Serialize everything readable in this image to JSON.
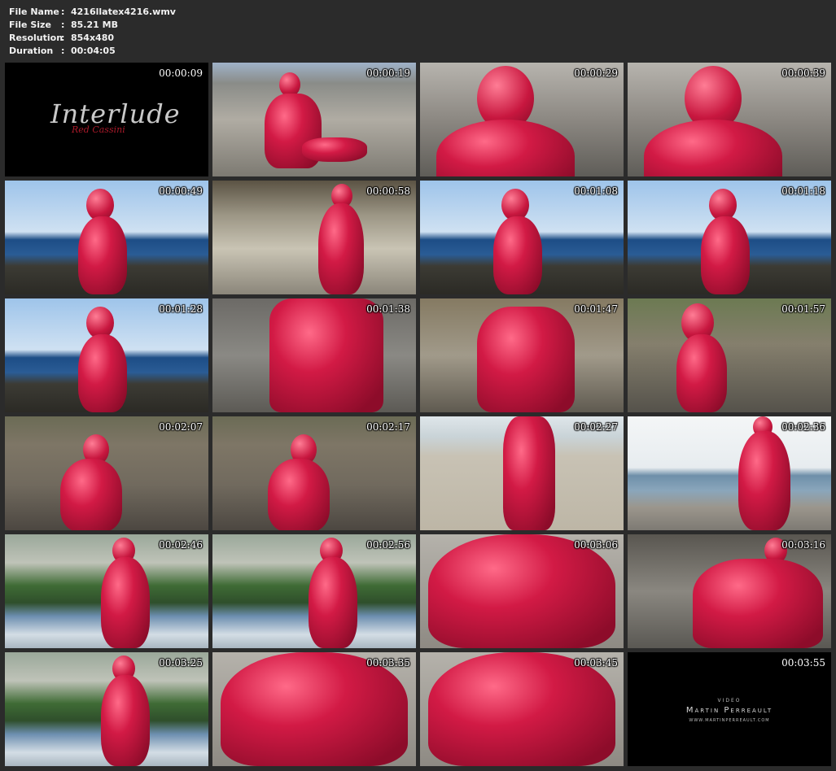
{
  "info": {
    "rows": [
      {
        "label": "File Name",
        "sep": ":",
        "value": "4216llatex4216.wmv"
      },
      {
        "label": "File Size",
        "sep": ":",
        "value": "85.21 MB"
      },
      {
        "label": "Resolution",
        "sep": ":",
        "value": "854x480"
      },
      {
        "label": "Duration",
        "sep": ":",
        "value": "00:04:05"
      }
    ]
  },
  "thumbnails": [
    {
      "time": "00:00:09",
      "title": "Interlude",
      "subtitle": "Red Cassini"
    },
    {
      "time": "00:00:19"
    },
    {
      "time": "00:00:29"
    },
    {
      "time": "00:00:39"
    },
    {
      "time": "00:00:49"
    },
    {
      "time": "00:00:58"
    },
    {
      "time": "00:01:08"
    },
    {
      "time": "00:01:18"
    },
    {
      "time": "00:01:28"
    },
    {
      "time": "00:01:38"
    },
    {
      "time": "00:01:47"
    },
    {
      "time": "00:01:57"
    },
    {
      "time": "00:02:07"
    },
    {
      "time": "00:02:17"
    },
    {
      "time": "00:02:27"
    },
    {
      "time": "00:02:36"
    },
    {
      "time": "00:02:46"
    },
    {
      "time": "00:02:56"
    },
    {
      "time": "00:03:06"
    },
    {
      "time": "00:03:16"
    },
    {
      "time": "00:03:25"
    },
    {
      "time": "00:03:35"
    },
    {
      "time": "00:03:45"
    },
    {
      "time": "00:03:55",
      "credit_top": "VIDEO",
      "credit_name": "Martin Perreault",
      "credit_url": "WWW.MARTINPERREAULT.COM"
    }
  ],
  "colors": {
    "background": "#2b2b2b",
    "latex_red": "#d21a45",
    "text": "#f2f2f2"
  }
}
